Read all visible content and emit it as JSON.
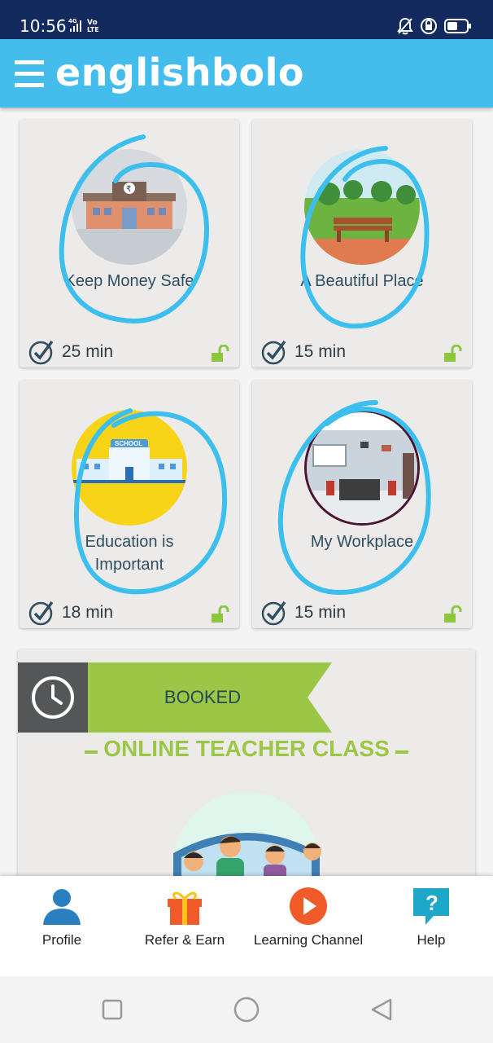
{
  "status_bar": {
    "time": "10:56",
    "network_top": "4G",
    "volte": "Vo\nLTE"
  },
  "app_bar": {
    "brand": "englishbolo",
    "menu_icon": "hamburger-icon"
  },
  "lessons": [
    {
      "title": "Keep Money Safe",
      "duration": "25 min",
      "icon": "bank-icon",
      "locked": false
    },
    {
      "title": "A Beautiful Place",
      "duration": "15 min",
      "icon": "park-bench-icon",
      "locked": false
    },
    {
      "title": "Education is Important",
      "duration": "18 min",
      "icon": "school-icon",
      "locked": false
    },
    {
      "title": "My Workplace",
      "duration": "15 min",
      "icon": "office-icon",
      "locked": false
    }
  ],
  "booking_card": {
    "status": "BOOKED",
    "title": "ONLINE TEACHER CLASS",
    "icon": "clock-icon"
  },
  "bottom_nav": [
    {
      "label": "Profile",
      "icon": "profile-icon"
    },
    {
      "label": "Refer & Earn",
      "icon": "gift-icon"
    },
    {
      "label": "Learning Channel",
      "icon": "play-icon"
    },
    {
      "label": "Help",
      "icon": "help-icon"
    }
  ],
  "colors": {
    "app_bar": "#44bdec",
    "status_bar": "#132a5e",
    "accent_green": "#9cc746",
    "scribble": "#3dbfee"
  }
}
